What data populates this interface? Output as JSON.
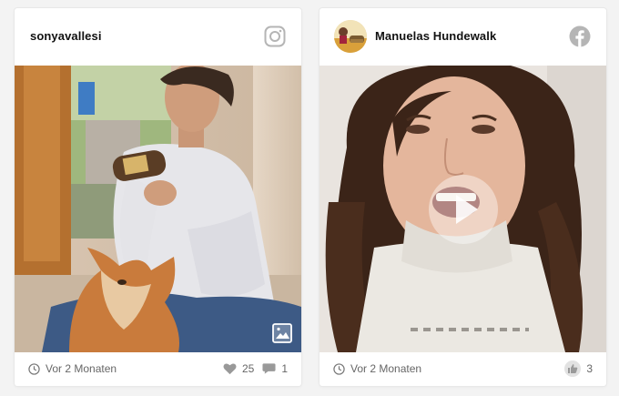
{
  "posts": [
    {
      "author": "sonyavallesi",
      "network_icon": "instagram-icon",
      "media_type": "image",
      "time_ago": "Vor 2 Monaten",
      "likes": "25",
      "comments": "1"
    },
    {
      "author": "Manuelas Hundewalk",
      "network_icon": "facebook-icon",
      "media_type": "video",
      "time_ago": "Vor 2 Monaten",
      "likes": "3"
    }
  ],
  "colors": {
    "page_bg": "#f3f3f3",
    "card_bg": "#ffffff",
    "icon_gray": "#b5b5b5",
    "meta_text": "#666666"
  }
}
